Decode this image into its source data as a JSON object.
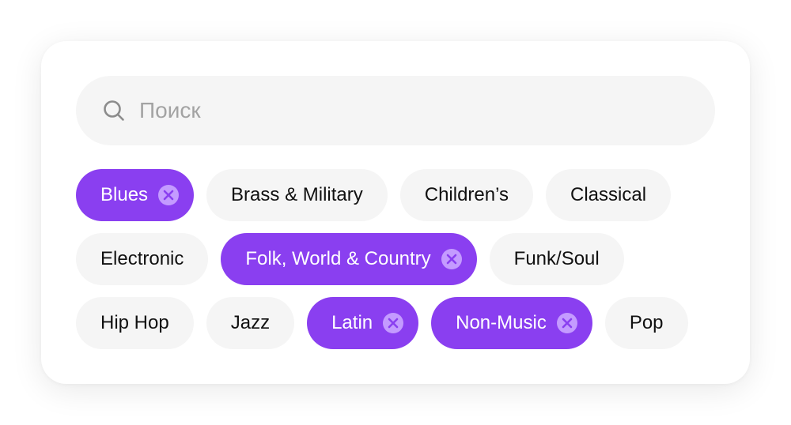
{
  "search": {
    "placeholder": "Поиск",
    "value": "",
    "icon": "search-icon"
  },
  "colors": {
    "accent": "#8a3ff0",
    "chip_bg": "#f5f5f5",
    "remove_icon_bg": "#c49bff"
  },
  "tags": [
    {
      "label": "Blues",
      "selected": true
    },
    {
      "label": "Brass & Military",
      "selected": false
    },
    {
      "label": "Children’s",
      "selected": false
    },
    {
      "label": "Classical",
      "selected": false
    },
    {
      "label": "Electronic",
      "selected": false
    },
    {
      "label": "Folk, World & Country",
      "selected": true
    },
    {
      "label": "Funk/Soul",
      "selected": false
    },
    {
      "label": "Hip Hop",
      "selected": false
    },
    {
      "label": "Jazz",
      "selected": false
    },
    {
      "label": "Latin",
      "selected": true
    },
    {
      "label": "Non-Music",
      "selected": true
    },
    {
      "label": "Pop",
      "selected": false
    }
  ]
}
